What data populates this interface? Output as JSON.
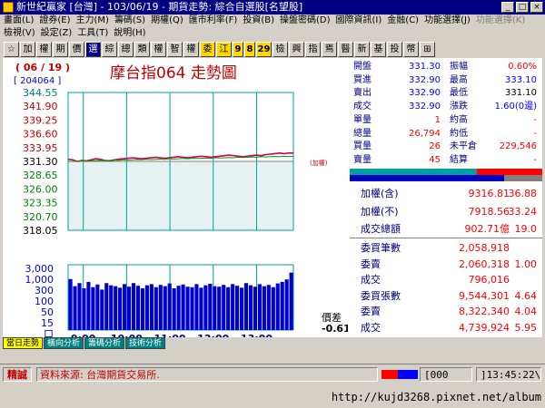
{
  "window": {
    "title": "新世紀贏家 [台灣] - 103/06/19 - 期貨走勢: 綜合自選股[名望股]",
    "buttons": [
      "_",
      "□",
      "×"
    ]
  },
  "menu": {
    "row1": [
      "畫面(L)",
      "證券(E)",
      "主力(M)",
      "籌碼(S)",
      "期權(Q)",
      "匯市利率(F)",
      "投資(B)",
      "操盤密碼(D)",
      "國際資訊(I)",
      "金融(C)",
      "功能選擇(J)"
    ],
    "row1_extra": "功能選擇(K)",
    "row2": [
      "檢視(V)",
      "設定(Z)",
      "工具(T)",
      "說明(H)"
    ]
  },
  "toolbar": {
    "buttons": [
      "☆",
      "加",
      "權",
      "期",
      "價",
      "選",
      "綜",
      "總",
      "類",
      "權",
      "智",
      "權",
      "委",
      "江",
      "9",
      "8",
      "29",
      "檢",
      "興",
      "指",
      "焉",
      "醫",
      "新",
      "基",
      "投",
      "幣",
      "⊞"
    ]
  },
  "chart_header": {
    "date": "( 06 / 19 )",
    "code": "[ 204064 ]",
    "title": "摩台指064  走勢圖",
    "ref_label": "(加權)"
  },
  "chart_data": {
    "type": "line",
    "title": "摩台指064  走勢圖",
    "price_ticks": [
      "344.55",
      "341.90",
      "339.25",
      "336.60",
      "333.95",
      "331.30",
      "328.65",
      "326.00",
      "323.35",
      "320.70",
      "318.05"
    ],
    "ylim": [
      318.05,
      344.55
    ],
    "reference_price": 331.3,
    "volume_ticks": [
      "3,000",
      "1,000",
      "300",
      "100",
      "50",
      "15",
      "口"
    ],
    "xticks": [
      "9:00",
      "10:00",
      "11:00",
      "12:00",
      "13:00"
    ],
    "series": [
      {
        "name": "price",
        "values": [
          331.7,
          331.6,
          331.3,
          331.5,
          331.4,
          331.6,
          331.8,
          331.7,
          331.5,
          331.4,
          331.6,
          331.7,
          331.8,
          331.9,
          332.0,
          331.9,
          331.8,
          331.9,
          332.0,
          332.1,
          332.0,
          331.9,
          332.0,
          332.1,
          332.2,
          332.1,
          332.0,
          332.1,
          332.2,
          332.3,
          332.2,
          332.1,
          332.2,
          332.3,
          332.4,
          332.5,
          332.4,
          332.3,
          332.2,
          332.3,
          332.4,
          332.5,
          332.4,
          332.6,
          332.7,
          332.8,
          332.9,
          332.8,
          332.9,
          332.9
        ]
      },
      {
        "name": "reference",
        "values": [
          331.3,
          331.3,
          331.35,
          331.4,
          331.35,
          331.4,
          331.45,
          331.5,
          331.45,
          331.5,
          331.55,
          331.5,
          331.6,
          331.55,
          331.6,
          331.65,
          331.6,
          331.7,
          331.65,
          331.7,
          331.75,
          331.7,
          331.8,
          331.75,
          331.8,
          331.85,
          331.8,
          331.9,
          331.85,
          331.9,
          331.95,
          331.9,
          332.0,
          331.95,
          332.0,
          332.05,
          332.0,
          332.1,
          332.05,
          332.1,
          332.15,
          332.1,
          332.2,
          332.15,
          332.2,
          332.25,
          332.2,
          332.3,
          332.25,
          332.3
        ]
      }
    ],
    "volume": [
      420,
      180,
      260,
      140,
      300,
      160,
      220,
      120,
      260,
      200,
      180,
      150,
      230,
      170,
      260,
      190,
      140,
      200,
      230,
      160,
      210,
      180,
      250,
      140,
      190,
      220,
      170,
      160,
      230,
      150,
      200,
      240,
      180,
      170,
      210,
      160,
      230,
      190,
      150,
      260,
      200,
      170,
      230,
      180,
      210,
      160,
      250,
      300,
      400,
      900
    ],
    "x_label": "",
    "y_label": ""
  },
  "chart_footer": {
    "spread_label": "價差",
    "spread_value": "-0.61"
  },
  "quote": {
    "rows": [
      {
        "l": "開盤",
        "v": "331.30",
        "vc": "blu",
        "l2": "振幅",
        "v2": "0.60%",
        "v2c": "red"
      },
      {
        "l": "買進",
        "v": "332.90",
        "vc": "blu",
        "l2": "最高",
        "v2": "333.10",
        "v2c": "blu"
      },
      {
        "l": "賣出",
        "v": "332.90",
        "vc": "blu",
        "l2": "最低",
        "v2": "331.10",
        "v2c": "blk"
      },
      {
        "l": "成交",
        "v": "332.90",
        "vc": "blu",
        "l2": "漲跌",
        "v2": "1.60(0邊)",
        "v2c": "blu"
      },
      {
        "l": "單量",
        "v": "1",
        "vc": "red",
        "l2": "約高",
        "v2": "-",
        "v2c": "red"
      },
      {
        "l": "總量",
        "v": "26,794",
        "vc": "red",
        "l2": "約低",
        "v2": "-",
        "v2c": "red"
      },
      {
        "l": "買量",
        "v": "26",
        "vc": "red",
        "l2": "未平倉",
        "v2": "229,546",
        "v2c": "red"
      },
      {
        "l": "賣量",
        "v": "45",
        "vc": "red",
        "l2": "結算",
        "v2": "-",
        "v2c": "red"
      }
    ],
    "index_rows": [
      {
        "l": "加權(含)",
        "v": "9316.81",
        "v2": "36.88"
      },
      {
        "l": "加權(不)",
        "v": "7918.56",
        "v2": "33.24"
      },
      {
        "l": "成交總額",
        "v": "902.71億",
        "v2": "19.0"
      }
    ],
    "order_rows": [
      {
        "l": "委買筆數",
        "v": "2,058,918",
        "v2": ""
      },
      {
        "l": "委賣",
        "v": "2,060,318",
        "v2": "1.00"
      },
      {
        "l": "成交",
        "v": "796,016",
        "v2": ""
      },
      {
        "l": "委買張數",
        "v": "9,544,301",
        "v2": "4.64"
      },
      {
        "l": "委賣",
        "v": "8,322,340",
        "v2": "4.04"
      },
      {
        "l": "成交",
        "v": "4,739,924",
        "v2": "5.95"
      }
    ]
  },
  "tabs": [
    "當日走勢",
    "橫向分析",
    "籌碼分析",
    "技術分析"
  ],
  "status": {
    "label": "精誠",
    "message": "資料來源: 台灣期貨交易所.",
    "counter": "[000",
    "clock": "]13:45:22\\"
  },
  "watermark": "http://kujd3268.pixnet.net/album"
}
